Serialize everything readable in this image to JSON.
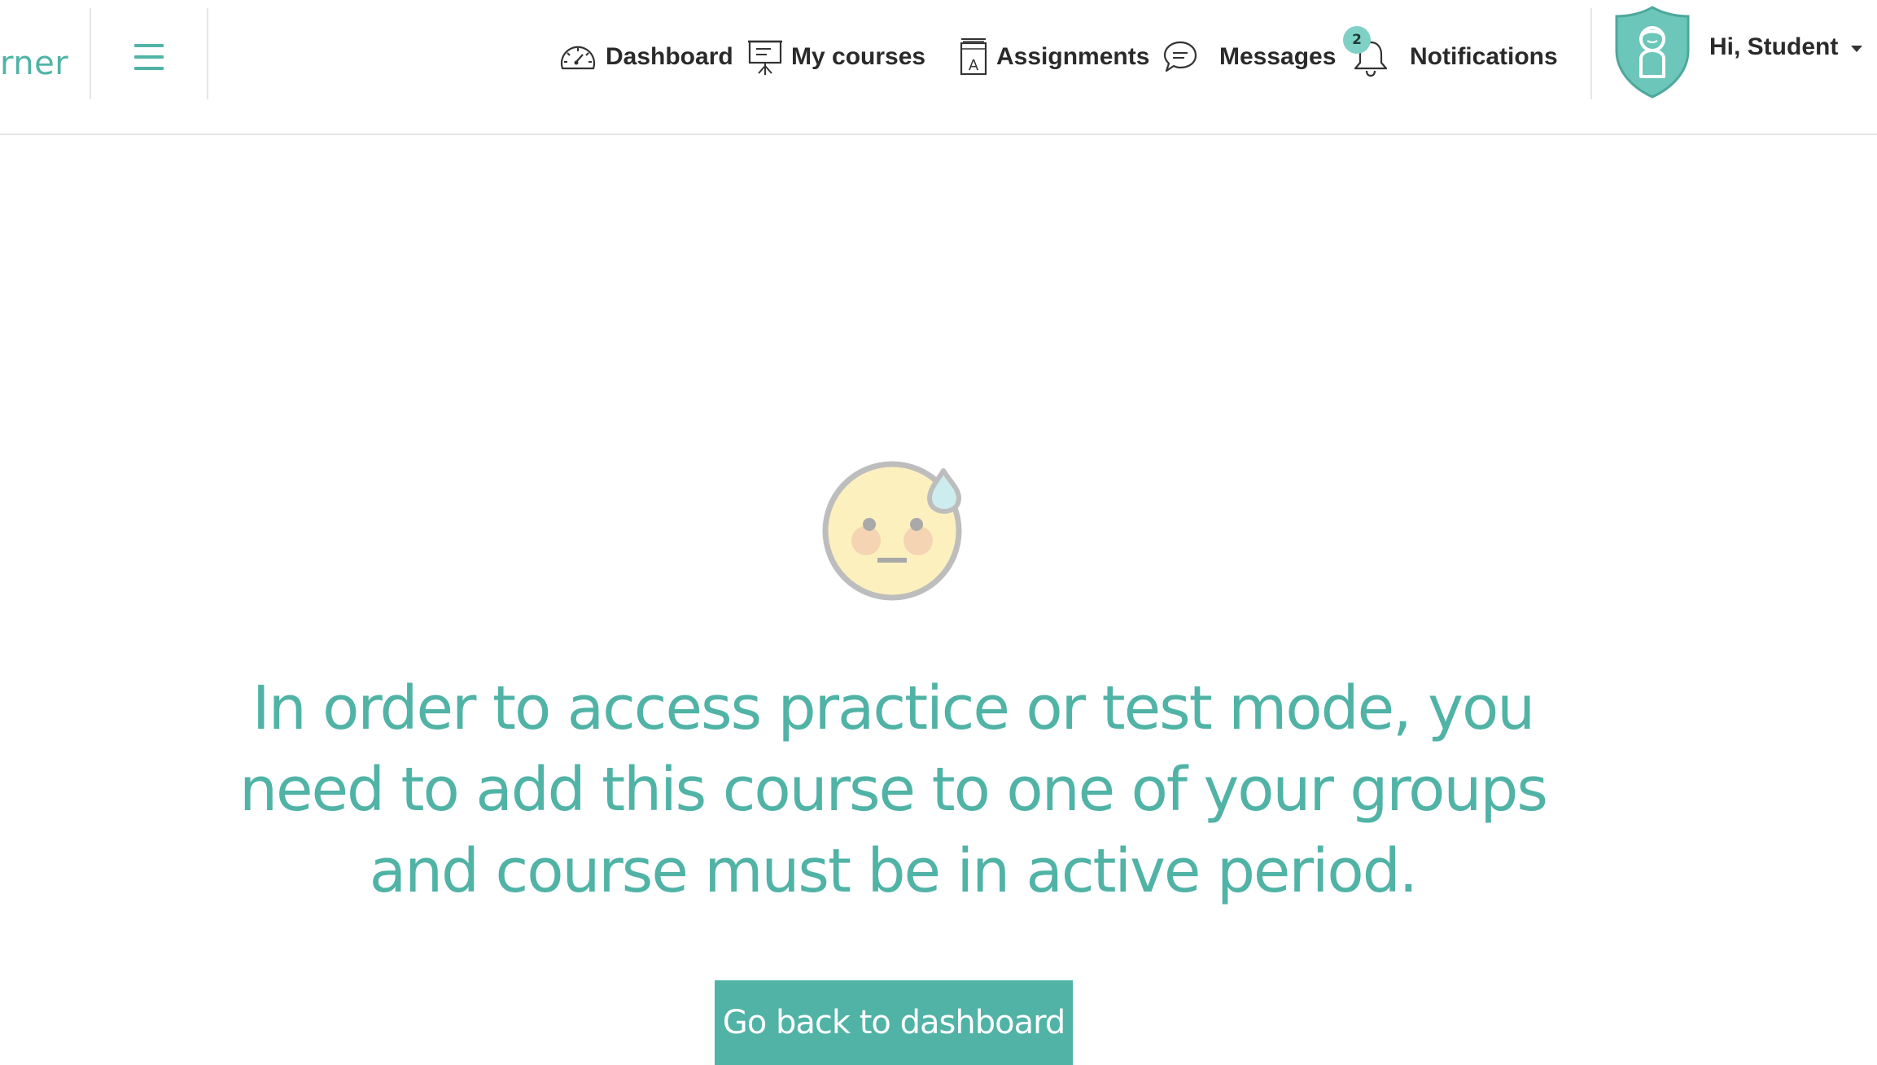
{
  "header": {
    "brand_text": "rner",
    "nav": {
      "dashboard": "Dashboard",
      "my_courses": "My courses",
      "assignments": "Assignments",
      "messages": "Messages",
      "notifications": "Notifications",
      "notifications_count": "2"
    },
    "user": {
      "greeting": "Hi, Student"
    }
  },
  "main": {
    "message_lines": [
      "In order to access practice or test mode, you",
      "need to add this course to one of your groups",
      "and course must be in active period."
    ],
    "back_button_label": "Go back to dashboard"
  },
  "icons": {
    "menu": "hamburger-icon",
    "dashboard": "speedometer-icon",
    "my_courses": "presentation-board-icon",
    "assignments": "document-a-icon",
    "messages": "speech-bubble-icon",
    "notifications": "bell-icon",
    "avatar": "student-shield-avatar-icon",
    "face": "sweating-face-icon"
  },
  "colors": {
    "accent": "#50b3a6",
    "badge": "#7fd1c6",
    "face_fill": "#fdf0bf",
    "face_outline": "#bdbdbd",
    "text_dark": "#2a2a2a"
  }
}
